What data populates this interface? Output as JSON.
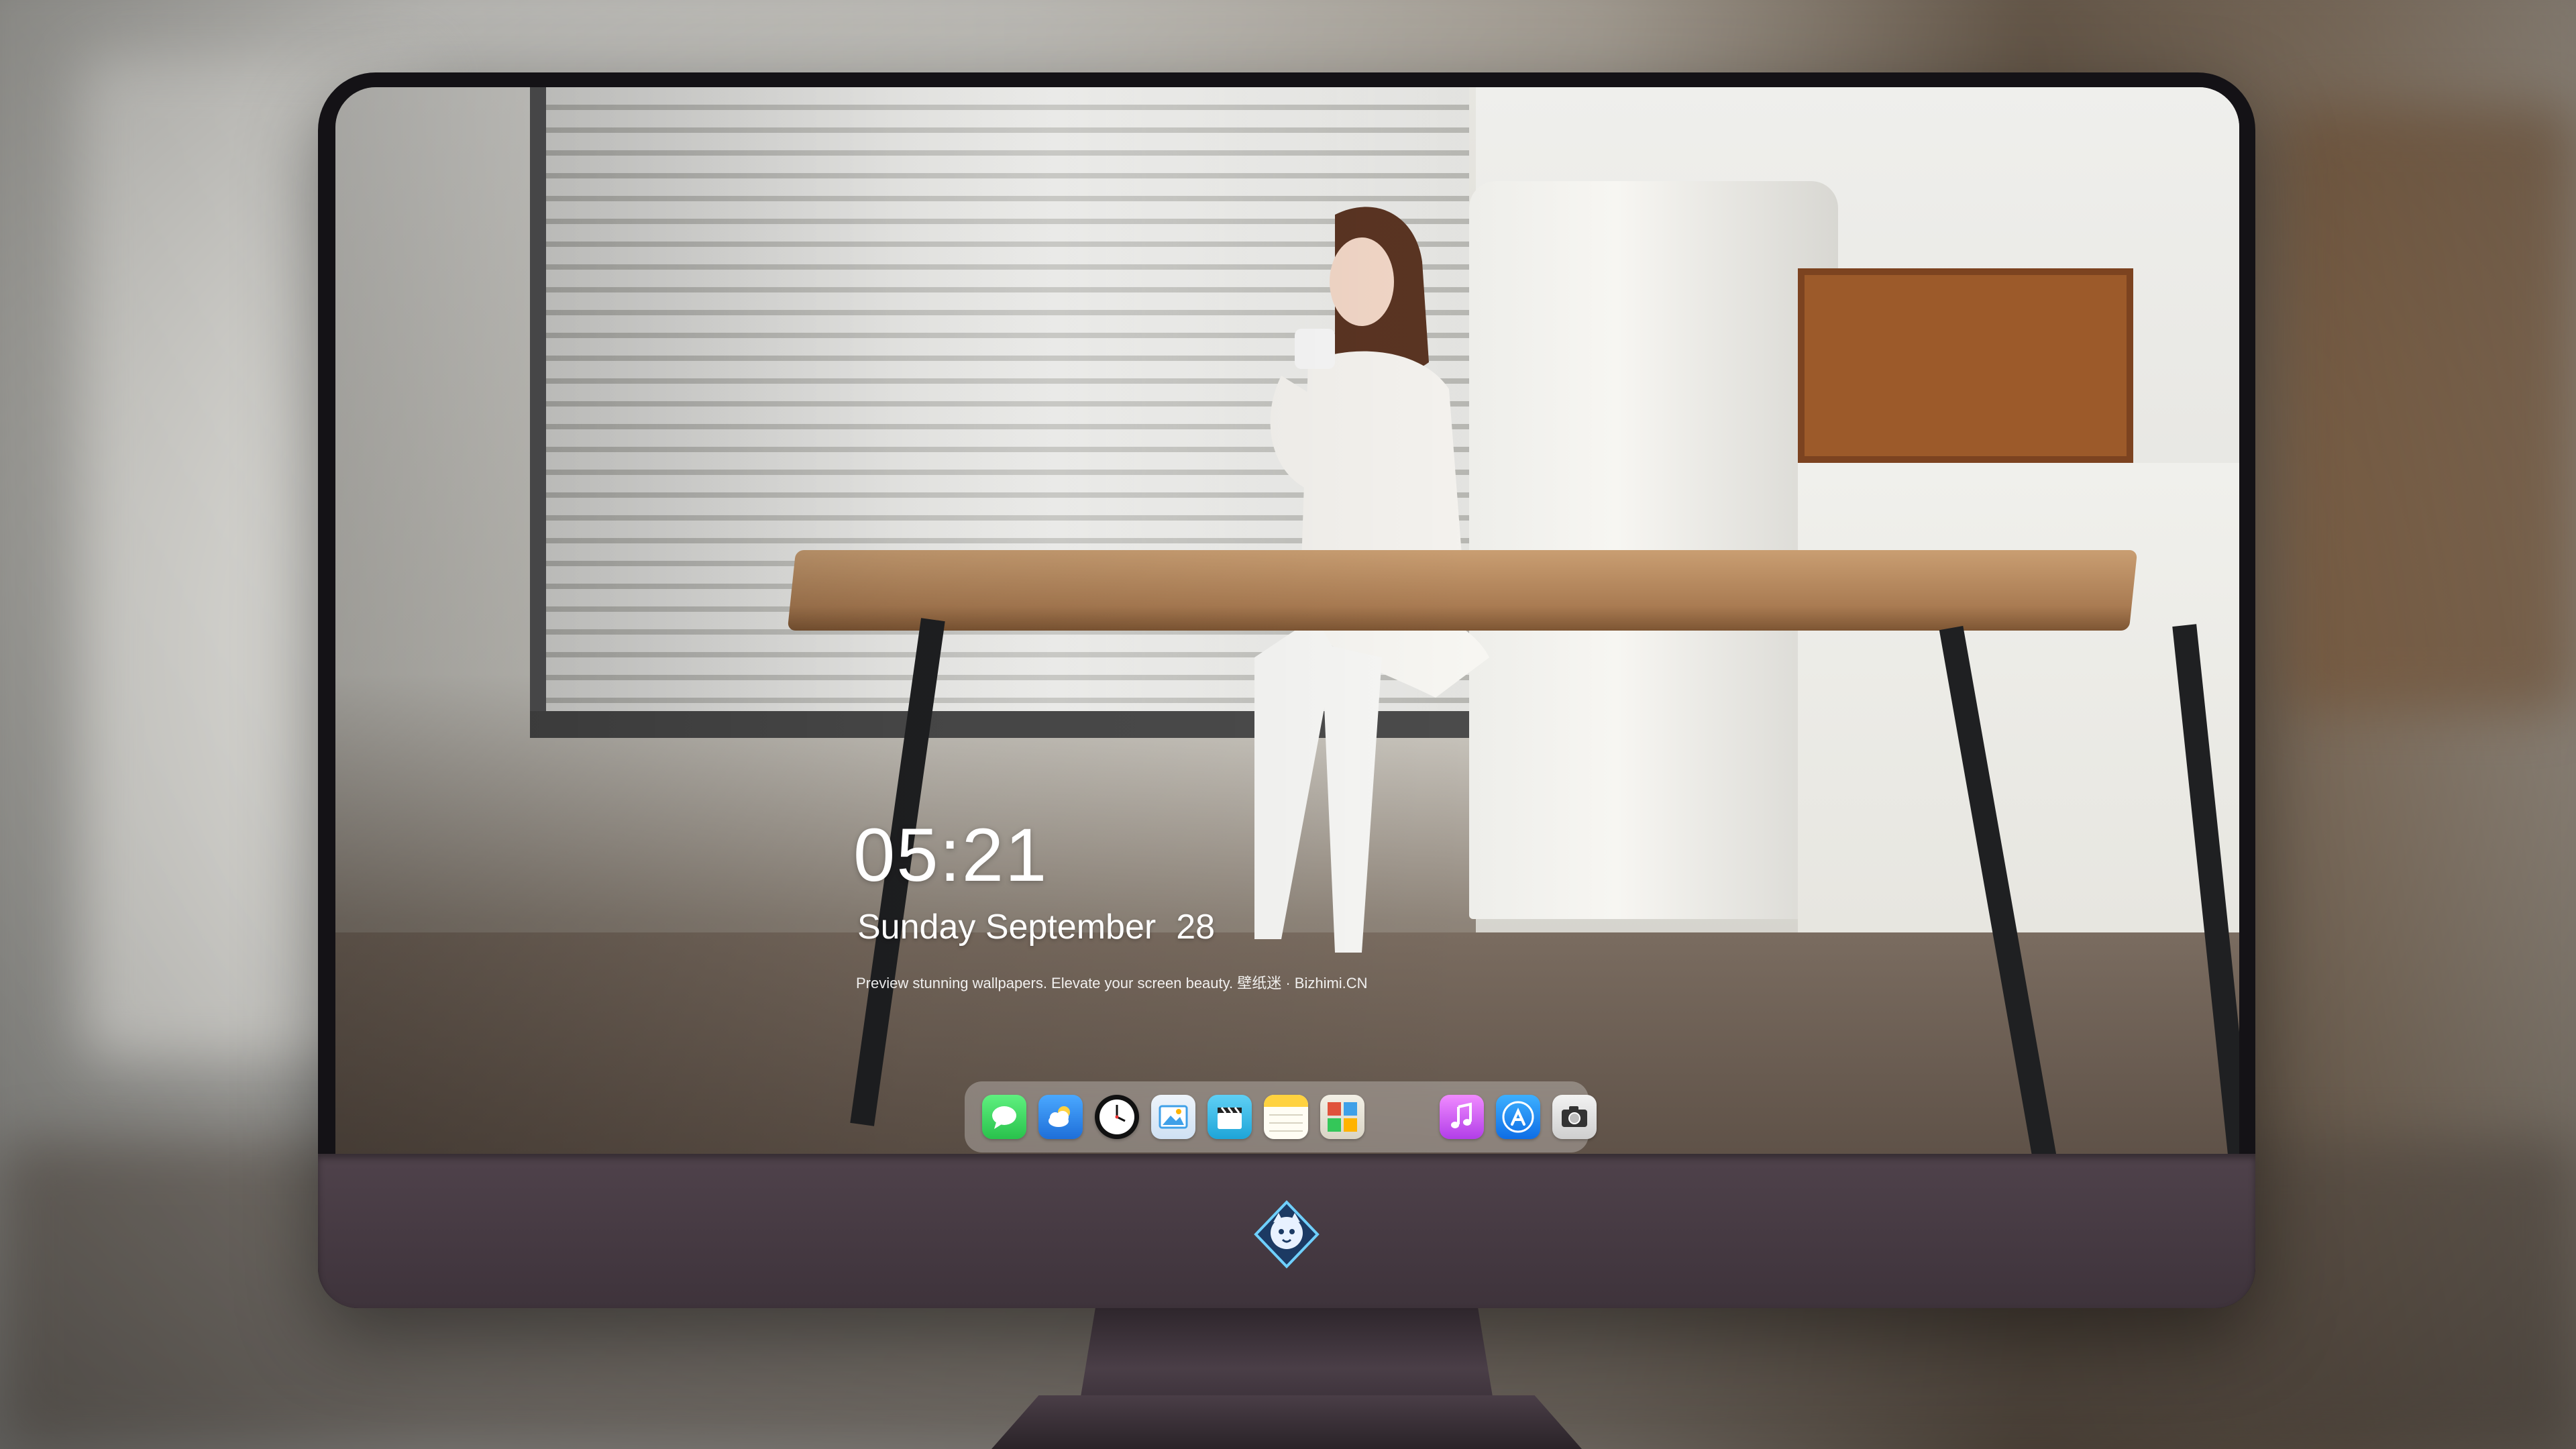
{
  "lock_screen": {
    "time": "05:21",
    "weekday": "Sunday",
    "month": "September",
    "day": "28",
    "tagline": "Preview stunning wallpapers. Elevate your screen beauty. 壁纸迷 · Bizhimi.CN"
  },
  "dock": {
    "apps": [
      {
        "name": "Messages",
        "icon": "speech-bubble-icon",
        "color": "#34c759"
      },
      {
        "name": "Weather",
        "icon": "cloud-sun-icon",
        "color": "#2f8ef4"
      },
      {
        "name": "Clock",
        "icon": "clock-icon",
        "color": "#111111"
      },
      {
        "name": "Preview",
        "icon": "photo-viewer-icon",
        "color": "#3fa0e8"
      },
      {
        "name": "Clips",
        "icon": "clapperboard-icon",
        "color": "#37b9e8"
      },
      {
        "name": "Notes",
        "icon": "notes-icon",
        "color": "#ffd23f"
      },
      {
        "name": "Photo Booth",
        "icon": "photo-booth-icon",
        "color": "#e9e6dc"
      },
      {
        "name": "iTunes",
        "icon": "music-note-icon",
        "color": "#d65bff"
      },
      {
        "name": "App Store",
        "icon": "app-store-icon",
        "color": "#1d8cf7"
      },
      {
        "name": "Camera",
        "icon": "camera-icon",
        "color": "#e5e5e5"
      }
    ]
  },
  "monitor": {
    "bezel_color": "#141216",
    "chin_color": "#4a3e47",
    "logo": "mascot-badge-icon"
  }
}
